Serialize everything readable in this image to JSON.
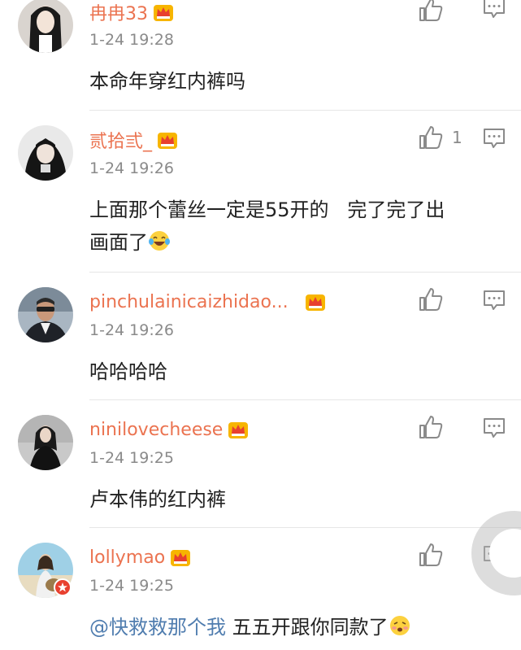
{
  "colors": {
    "username": "#eb7350",
    "time": "#8a8a8a",
    "text": "#222222",
    "mention": "#507daf",
    "divider": "#e6e6e6"
  },
  "comments": [
    {
      "username": "冉冉33",
      "time": "1-24 19:28",
      "text": "本命年穿红内裤吗",
      "like_count": ""
    },
    {
      "username": "贰拾弎_",
      "time": "1-24 19:26",
      "text_line1": "上面那个蕾丝一定是55开的   完了完了出",
      "text_line2": "画面了",
      "like_count": "1"
    },
    {
      "username": "pinchulainicaizhidao...",
      "time": "1-24 19:26",
      "text": "哈哈哈哈",
      "like_count": ""
    },
    {
      "username": "ninilovecheese",
      "time": "1-24 19:25",
      "text": "卢本伟的红内裤",
      "like_count": ""
    },
    {
      "username": "lollymao",
      "time": "1-24 19:25",
      "mention": "@快救救那个我",
      "text": " 五五开跟你同款了",
      "like_count": ""
    }
  ],
  "icons": {
    "crown": "vip-crown-icon",
    "like": "thumbs-up-icon",
    "reply": "comment-bubble-icon",
    "laugh": "laughing-tears-emoji",
    "shy": "shy-face-emoji"
  }
}
